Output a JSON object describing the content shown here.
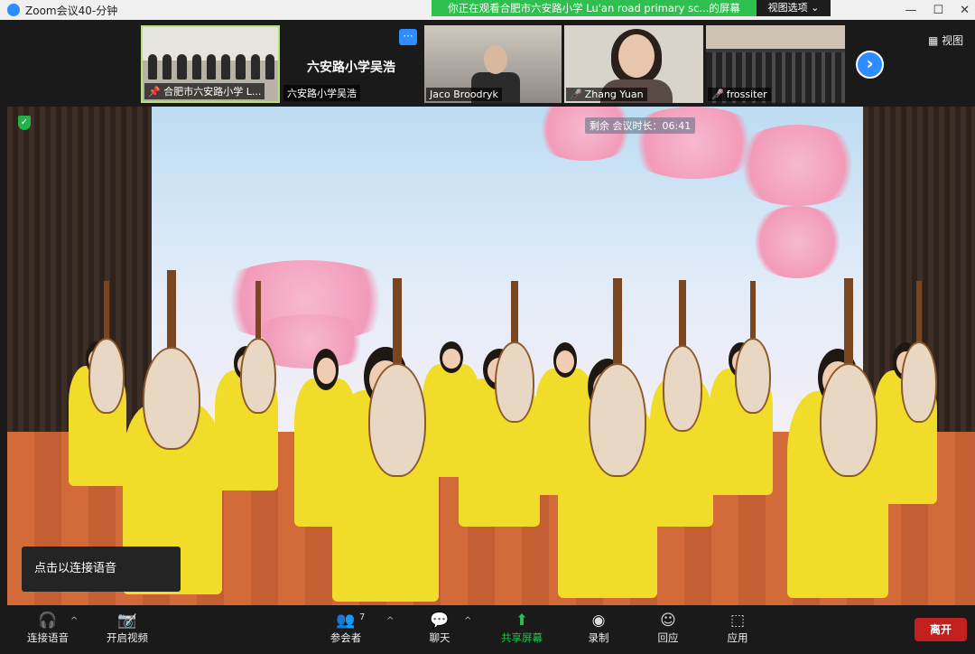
{
  "window": {
    "title": "Zoom会议40-分钟",
    "share_banner": "你正在观看合肥市六安路小学 Lu'an road primary sc...的屏幕",
    "view_options": "视图选项",
    "view_button": "视图"
  },
  "thumbnails": [
    {
      "name": "合肥市六安路小学 L..."
    },
    {
      "name": "六安路小学吴浩",
      "big_name": "六安路小学吴浩"
    },
    {
      "name": "Jaco Broodryk"
    },
    {
      "name": "Zhang Yuan"
    },
    {
      "name": "frossiter"
    }
  ],
  "stage": {
    "timer": "剩余 会议时长：06:41"
  },
  "tooltip": {
    "connect_audio": "点击以连接语音"
  },
  "toolbar": {
    "audio_label": "连接语音",
    "video_label": "开启视频",
    "participants_label": "参会者",
    "participants_count": "7",
    "chat_label": "聊天",
    "share_label": "共享屏幕",
    "record_label": "录制",
    "reactions_label": "回应",
    "apps_label": "应用",
    "leave_label": "离开"
  },
  "colors": {
    "accent": "#2d8cff",
    "share_green": "#23c14d",
    "leave_red": "#c32020",
    "banner_green": "#2fbf4f"
  }
}
